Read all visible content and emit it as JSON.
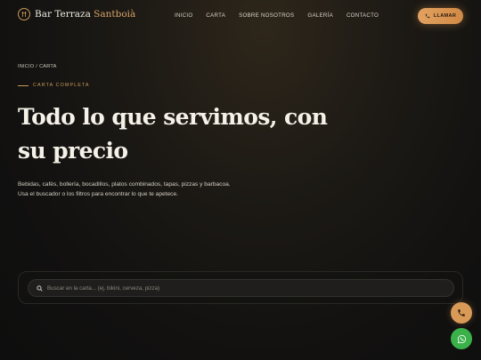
{
  "header": {
    "logo_text_main": "Bar Terraza",
    "logo_text_accent": "Santboià",
    "nav": [
      "INICIO",
      "CARTA",
      "SOBRE NOSOTROS",
      "GALERÍA",
      "CONTACTO"
    ],
    "call_label": "LLAMAR"
  },
  "hero": {
    "breadcrumb_home": "INICIO",
    "breadcrumb_sep": "/",
    "breadcrumb_current": "CARTA",
    "eyebrow": "CARTA COMPLETA",
    "title": "Todo lo que servimos, con su precio",
    "description": "Bebidas, cafés, bollería, bocadillos, platos combinados, tapas, pizzas y barbacoa. Usa el buscador o los filtros para encontrar lo que te apetece."
  },
  "search": {
    "placeholder": "Buscar en la carta... (ej. bikini, cerveza, pizza)"
  },
  "colors": {
    "accent": "#d6a468",
    "whatsapp": "#3bb14a"
  },
  "icons": {
    "logo": "logo-mark-icon",
    "call": "phone-icon",
    "search": "search-icon",
    "fab_phone": "phone-icon",
    "fab_whatsapp": "whatsapp-icon"
  }
}
